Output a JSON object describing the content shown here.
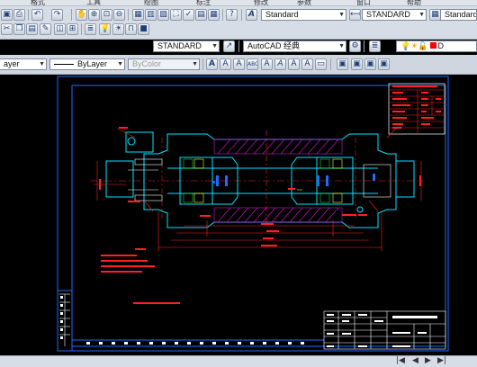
{
  "menubar": {
    "items": [
      "格式",
      "工具",
      "绘图",
      "标注",
      "修改",
      "参数",
      "窗口",
      "帮助"
    ]
  },
  "toolbar1": {
    "text_style": "Standard",
    "dim_style": "STANDARD",
    "table_style": "Standard",
    "layer_color_label": "D"
  },
  "toolbar2": {
    "text_style2": "STANDARD",
    "workspace": "AutoCAD 经典"
  },
  "toolbar3": {
    "layer": "ayer",
    "linetype": "ByLayer",
    "color": "ByColor"
  },
  "colors": {
    "frame": "#1f6bff",
    "part": "#00e5ff",
    "dim": "#ff2020",
    "hatch": "#d014d0",
    "white": "#ffffff",
    "yellow": "#ffff00",
    "green": "#22ff22"
  }
}
